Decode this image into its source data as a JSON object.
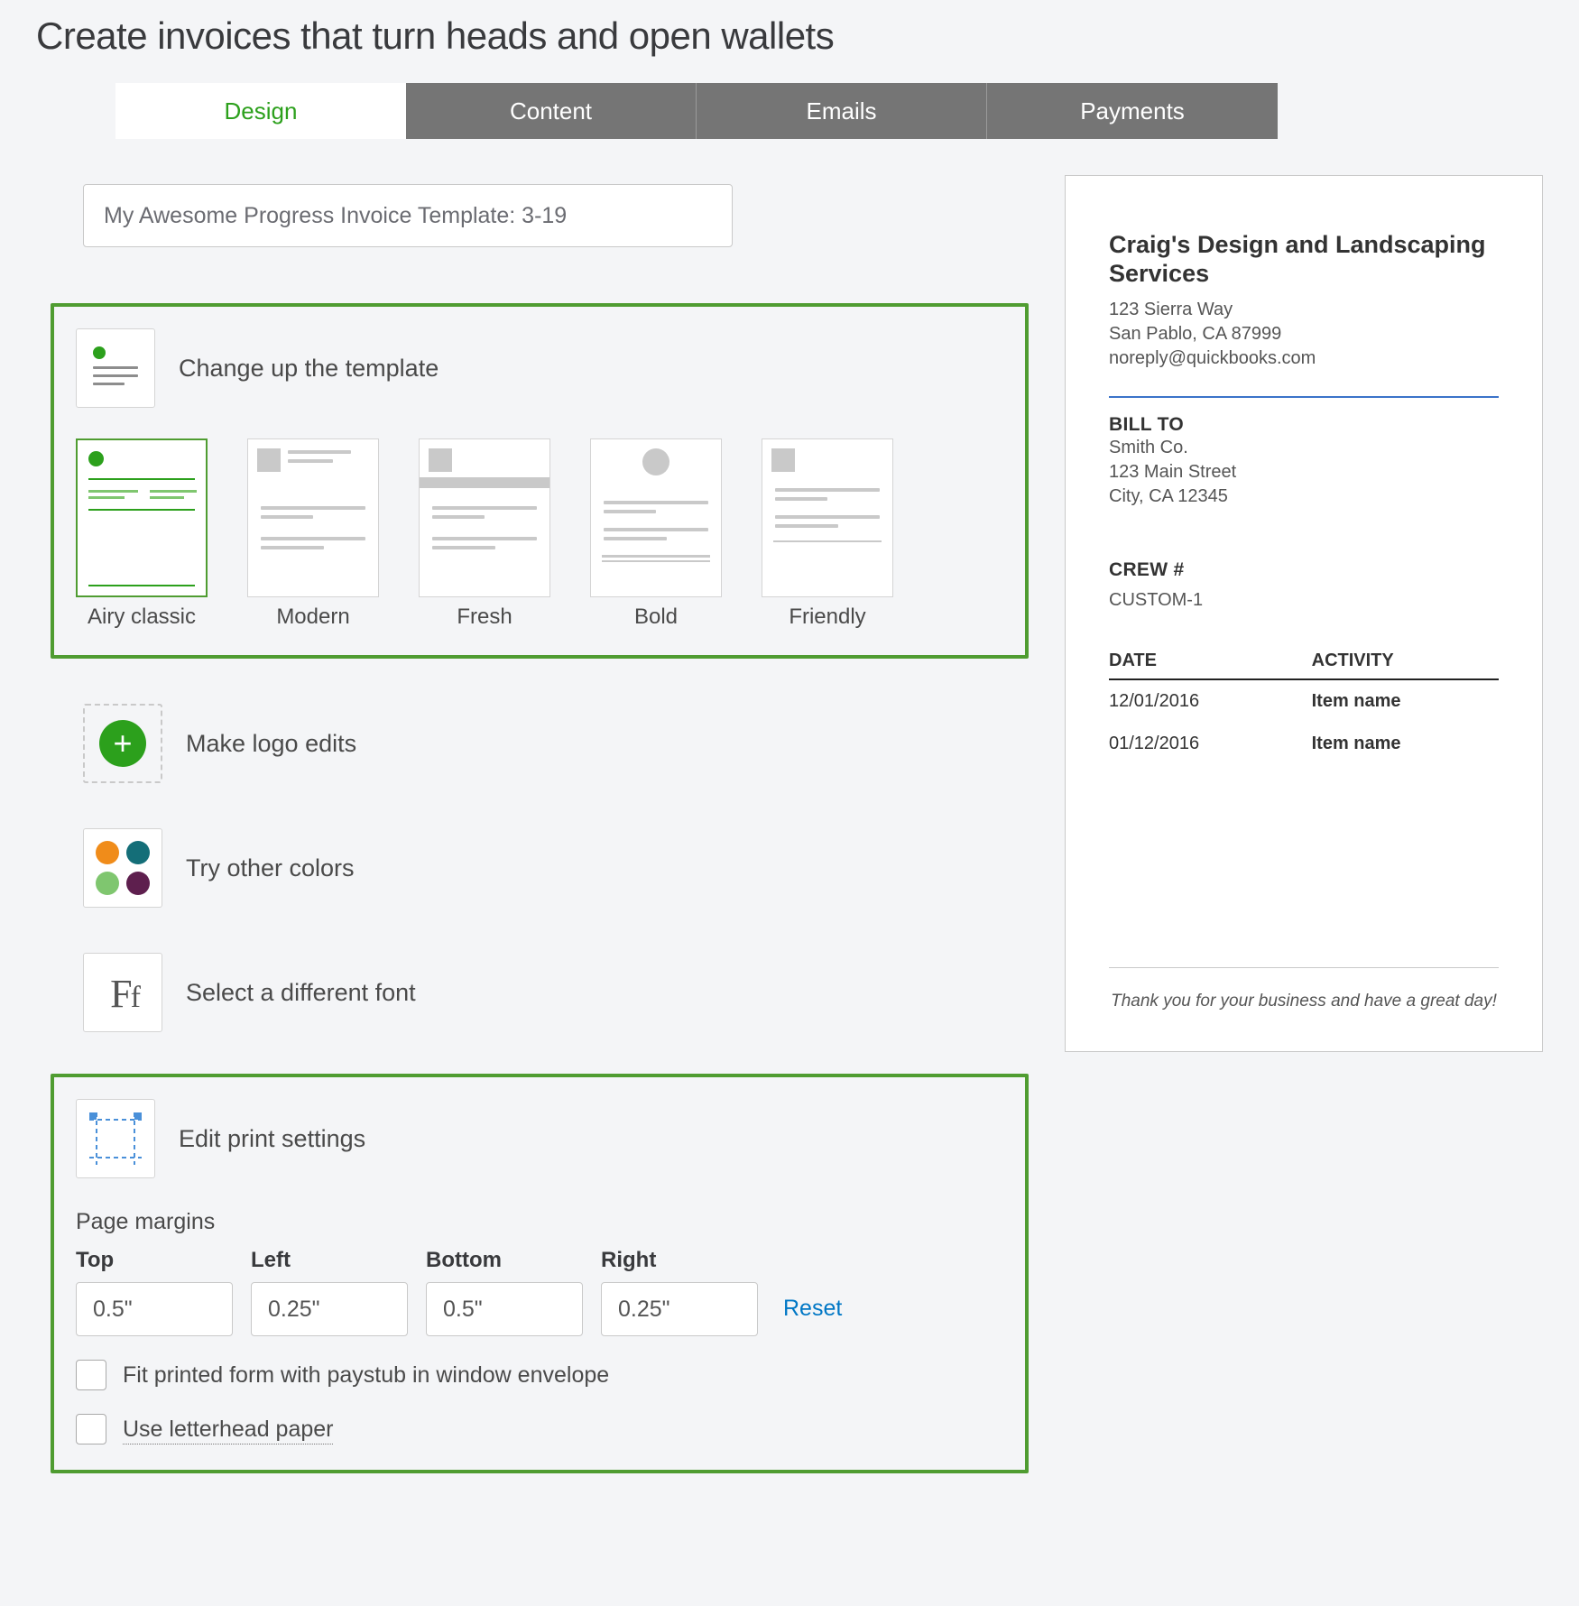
{
  "header": {
    "title": "Create invoices that turn heads and open wallets"
  },
  "tabs": {
    "items": [
      "Design",
      "Content",
      "Emails",
      "Payments"
    ],
    "active_index": 0
  },
  "template_name": "My Awesome Progress Invoice Template: 3-19",
  "sections": {
    "template": {
      "label": "Change up the template"
    },
    "logo": {
      "label": "Make logo edits"
    },
    "colors": {
      "label": "Try other colors"
    },
    "font": {
      "label": "Select a different font"
    },
    "print": {
      "label": "Edit print settings"
    }
  },
  "template_styles": [
    {
      "name": "Airy classic",
      "selected": true
    },
    {
      "name": "Modern",
      "selected": false
    },
    {
      "name": "Fresh",
      "selected": false
    },
    {
      "name": "Bold",
      "selected": false
    },
    {
      "name": "Friendly",
      "selected": false
    }
  ],
  "color_swatches": [
    "#f08c1a",
    "#146e78",
    "#7fc66f",
    "#5e1f4e"
  ],
  "print_settings": {
    "margins_title": "Page margins",
    "margins": {
      "top": {
        "label": "Top",
        "value": "0.5\""
      },
      "left": {
        "label": "Left",
        "value": "0.25\""
      },
      "bottom": {
        "label": "Bottom",
        "value": "0.5\""
      },
      "right": {
        "label": "Right",
        "value": "0.25\""
      }
    },
    "reset_label": "Reset",
    "fit_envelope_label": "Fit printed form with paystub in window envelope",
    "letterhead_label": "Use letterhead paper",
    "fit_envelope_checked": false,
    "letterhead_checked": false
  },
  "preview": {
    "company_name": "Craig's Design and Landscaping Services",
    "address_line1": "123 Sierra Way",
    "address_line2": "San Pablo, CA 87999",
    "email": "noreply@quickbooks.com",
    "bill_to_label": "BILL TO",
    "bill_to": {
      "name": "Smith Co.",
      "line1": "123 Main Street",
      "line2": "City, CA 12345"
    },
    "crew_label": "CREW #",
    "crew_value": "CUSTOM-1",
    "table": {
      "columns": [
        "DATE",
        "ACTIVITY"
      ],
      "rows": [
        {
          "date": "12/01/2016",
          "activity": "Item name"
        },
        {
          "date": "01/12/2016",
          "activity": "Item name"
        }
      ]
    },
    "footer_note": "Thank you for your business and have a great day!"
  }
}
